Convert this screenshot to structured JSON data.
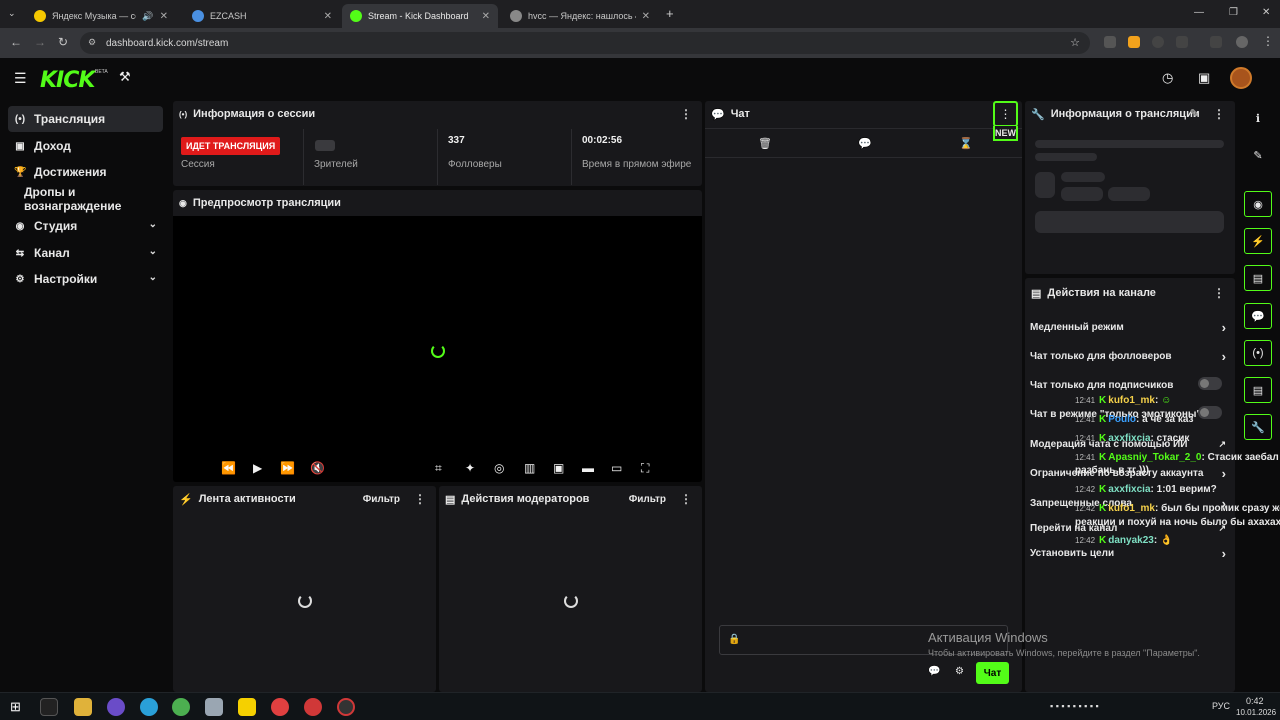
{
  "browser": {
    "tabs": [
      {
        "title": "Яндекс Музыка — собирае",
        "icon": "yandex-music-icon",
        "audio": true
      },
      {
        "title": "EZCASH",
        "icon": "globe-icon"
      },
      {
        "title": "Stream - Kick Dashboard",
        "icon": "kick-icon",
        "active": true
      },
      {
        "title": "hvcc — Яндекс: нашлось 4 млн",
        "icon": "yandex-icon"
      }
    ],
    "url": "dashboard.kick.com/stream"
  },
  "logo": {
    "text": "KICK",
    "beta": "BETA"
  },
  "sidebar": {
    "items": [
      {
        "label": "Трансляция",
        "icon": "broadcast-icon",
        "active": true
      },
      {
        "label": "Доход",
        "icon": "wallet-icon"
      },
      {
        "label": "Достижения",
        "icon": "trophy-icon"
      },
      {
        "label": "Дропы и вознаграждение"
      },
      {
        "label": "Студия",
        "icon": "studio-icon",
        "expandable": true
      },
      {
        "label": "Канал",
        "icon": "channel-icon",
        "expandable": true
      },
      {
        "label": "Настройки",
        "icon": "settings-icon",
        "expandable": true
      }
    ]
  },
  "session": {
    "title": "Информация о сессии",
    "live_badge": "ИДЕТ ТРАНСЛЯЦИЯ",
    "session_label": "Сессия",
    "viewers_label": "Зрителей",
    "followers_value": "337",
    "followers_label": "Фолловеры",
    "uptime_value": "00:02:56",
    "uptime_label": "Время в прямом эфире"
  },
  "preview": {
    "title": "Предпросмотр трансляции"
  },
  "activity": {
    "title": "Лента активности",
    "filter": "Фильтр"
  },
  "modactions": {
    "title": "Действия модераторов",
    "filter": "Фильтр"
  },
  "chat": {
    "title": "Чат",
    "new_badge": "NEW",
    "send_label": "Чат",
    "messages": [
      {
        "time": "12:41",
        "user": "kufo1_mk",
        "text": "",
        "user_color": "#f5d14a"
      },
      {
        "time": "12:41",
        "user": "Poulo",
        "text": "а чё за каз",
        "user_color": "#3aa0ff"
      },
      {
        "time": "12:41",
        "user": "axxfixcia",
        "text": "стасик",
        "user_color": "#7fe0c4"
      },
      {
        "time": "12:41",
        "user": "Apasniy_Tokar_2_0",
        "text": "Стасик заебал",
        "user_color": "#53fc18"
      },
      {
        "time": "",
        "user": "",
        "text": "разбань в тг )))",
        "user_color": "#e8e8e8"
      },
      {
        "time": "12:42",
        "user": "axxfixcia",
        "text": "1:01 верим?",
        "user_color": "#7fe0c4"
      },
      {
        "time": "12:42",
        "user": "kufo1_mk",
        "text": "был бы промик сразу же",
        "user_color": "#f5d14a"
      },
      {
        "time": "",
        "user": "",
        "text": "реакции и похуй на ночь было бы ахахаха",
        "user_color": "#e8e8e8"
      },
      {
        "time": "12:42",
        "user": "danyak23",
        "text": "",
        "user_color": "#7fe0c4"
      }
    ]
  },
  "stream_info": {
    "title": "Информация о трансляции"
  },
  "channel_actions": {
    "title": "Действия на канале",
    "items": [
      {
        "label": "Медленный режим",
        "control": "chevron"
      },
      {
        "label": "Чат только для фолловеров",
        "control": "chevron"
      },
      {
        "label": "Чат только для подписчиков",
        "control": "toggle"
      },
      {
        "label": "Чат в режиме \"только эмотиконы\"",
        "control": "toggle"
      },
      {
        "label": "Модерация чата с помощью ИИ",
        "control": "external"
      },
      {
        "label": "Ограничение по возрасту аккаунта",
        "control": "chevron"
      },
      {
        "label": "Запрещенные слова",
        "control": "chevron"
      },
      {
        "label": "Перейти на канал",
        "control": "external"
      },
      {
        "label": "Установить цели",
        "control": "chevron"
      }
    ]
  },
  "windows_activation": {
    "title": "Активация Windows",
    "subtitle": "Чтобы активировать Windows, перейдите в раздел \"Параметры\"."
  },
  "taskbar": {
    "lang": "РУС",
    "time": "0:42",
    "date": "10.01.2026"
  }
}
